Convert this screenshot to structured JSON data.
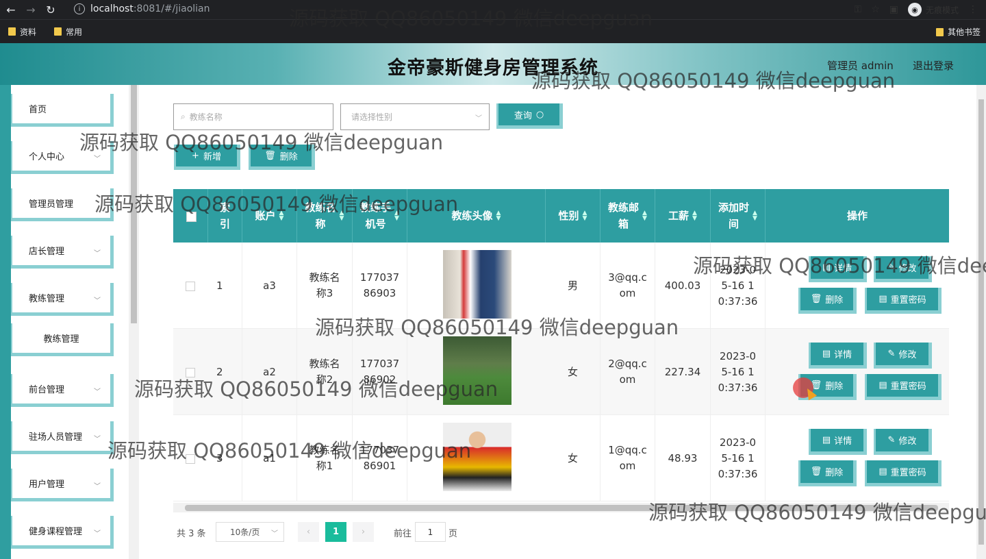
{
  "browser": {
    "url_host": "localhost",
    "url_rest": ":8081/#/jiaolian",
    "incognito_label": "无痕模式",
    "bookmarks": [
      "资料",
      "常用"
    ],
    "other_bookmarks": "其他书签"
  },
  "header": {
    "title": "金帝豪斯健身房管理系统",
    "admin": "管理员 admin",
    "logout": "退出登录"
  },
  "sidebar": {
    "items": [
      {
        "label": "首页"
      },
      {
        "label": "个人中心"
      },
      {
        "label": "管理员管理"
      },
      {
        "label": "店长管理"
      },
      {
        "label": "教练管理"
      },
      {
        "label": "教练管理"
      },
      {
        "label": "前台管理"
      },
      {
        "label": "驻场人员管理"
      },
      {
        "label": "用户管理"
      },
      {
        "label": "健身课程管理"
      }
    ]
  },
  "filters": {
    "name_placeholder": "教练名称",
    "gender_placeholder": "请选择性别",
    "query_label": "查询",
    "add_label": "新增",
    "delete_label": "删除"
  },
  "table": {
    "headers": [
      "索引",
      "账户",
      "教练名称",
      "教练手机号",
      "教练头像",
      "性别",
      "教练邮箱",
      "工薪",
      "添加时间",
      "操作"
    ],
    "headers_lines": [
      [
        "索",
        "引"
      ],
      [
        "账户"
      ],
      [
        "教练名",
        "称"
      ],
      [
        "教练手",
        "机号"
      ],
      [
        "教练头像"
      ],
      [
        "性别"
      ],
      [
        "教练邮",
        "箱"
      ],
      [
        "工薪"
      ],
      [
        "添加时",
        "间"
      ],
      [
        "操作"
      ]
    ],
    "rows": [
      {
        "index": "1",
        "account": "a3",
        "name": [
          "教练名",
          "称3"
        ],
        "phone": [
          "177037",
          "86903"
        ],
        "gender": "男",
        "email": [
          "3@qq.c",
          "om"
        ],
        "salary": "400.03",
        "time": [
          "2023-0",
          "5-16 1",
          "0:37:36"
        ],
        "photo": "coach-photo-3"
      },
      {
        "index": "2",
        "account": "a2",
        "name": [
          "教练名",
          "称2"
        ],
        "phone": [
          "177037",
          "86902"
        ],
        "gender": "女",
        "email": [
          "2@qq.c",
          "om"
        ],
        "salary": "227.34",
        "time": [
          "2023-0",
          "5-16 1",
          "0:37:36"
        ],
        "photo": "coach-photo-2"
      },
      {
        "index": "3",
        "account": "a1",
        "name": [
          "教练名",
          "称1"
        ],
        "phone": [
          "177037",
          "86901"
        ],
        "gender": "女",
        "email": [
          "1@qq.c",
          "om"
        ],
        "salary": "48.93",
        "time": [
          "2023-0",
          "5-16 1",
          "0:37:36"
        ],
        "photo": "coach-photo-1"
      }
    ],
    "actions": {
      "detail": "详情",
      "edit": "修改",
      "delete": "删除",
      "reset": "重置密码"
    }
  },
  "pagination": {
    "total": "共 3 条",
    "page_size": "10条/页",
    "current": "1",
    "goto_label": "前往",
    "goto_value": "1",
    "page_suffix": "页"
  },
  "watermark": "源码获取 QQ86050149 微信deepguan",
  "colors": {
    "primary": "#2e9ea1",
    "accent": "#8acfd2",
    "active_page": "#1abc9c"
  }
}
